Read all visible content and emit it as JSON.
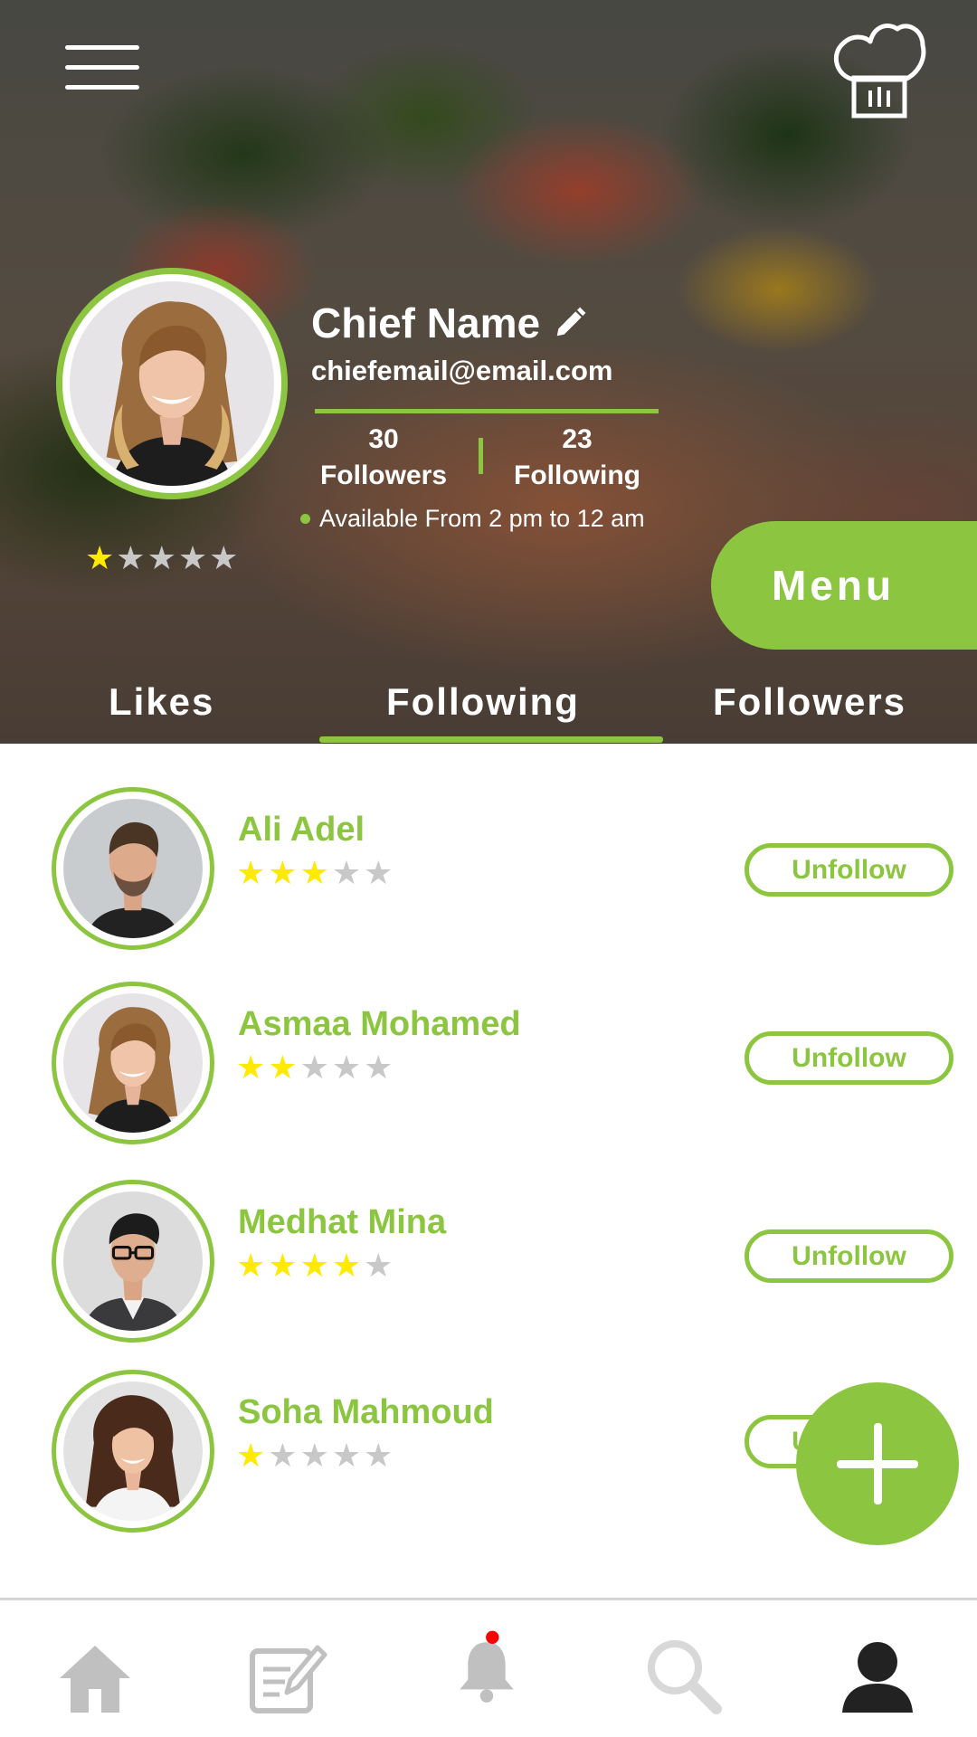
{
  "header": {
    "menu_icon": "hamburger-icon",
    "chef_icon": "chef-hat-icon"
  },
  "profile": {
    "name": "Chief Name",
    "email": "chiefemail@email.com",
    "followers_count": "30",
    "followers_label": "Followers",
    "following_count": "23",
    "following_label": "Following",
    "availability": "Available From 2 pm to 12 am",
    "rating": 1,
    "rating_max": 5,
    "menu_button": "Menu"
  },
  "tabs": [
    {
      "label": "Likes",
      "active": false
    },
    {
      "label": "Following",
      "active": true
    },
    {
      "label": "Followers",
      "active": false
    }
  ],
  "following_list": [
    {
      "name": "Ali Adel",
      "rating": 3,
      "action": "Unfollow"
    },
    {
      "name": "Asmaa Mohamed",
      "rating": 2,
      "action": "Unfollow"
    },
    {
      "name": "Medhat Mina",
      "rating": 4,
      "action": "Unfollow"
    },
    {
      "name": "Soha Mahmoud",
      "rating": 1,
      "action": "Unfollow"
    }
  ],
  "fab": {
    "icon": "plus-icon"
  },
  "bottom_nav": [
    {
      "icon": "home-icon",
      "active": false
    },
    {
      "icon": "edit-notes-icon",
      "active": false
    },
    {
      "icon": "bell-icon",
      "active": false,
      "badge": true
    },
    {
      "icon": "search-icon",
      "active": false
    },
    {
      "icon": "profile-icon",
      "active": true
    }
  ],
  "colors": {
    "accent": "#8cc540",
    "star": "#ffea00",
    "star_off": "#c8c8c8",
    "badge": "#ff0000",
    "nav_inactive": "#c0c0c0",
    "nav_active": "#222222"
  }
}
